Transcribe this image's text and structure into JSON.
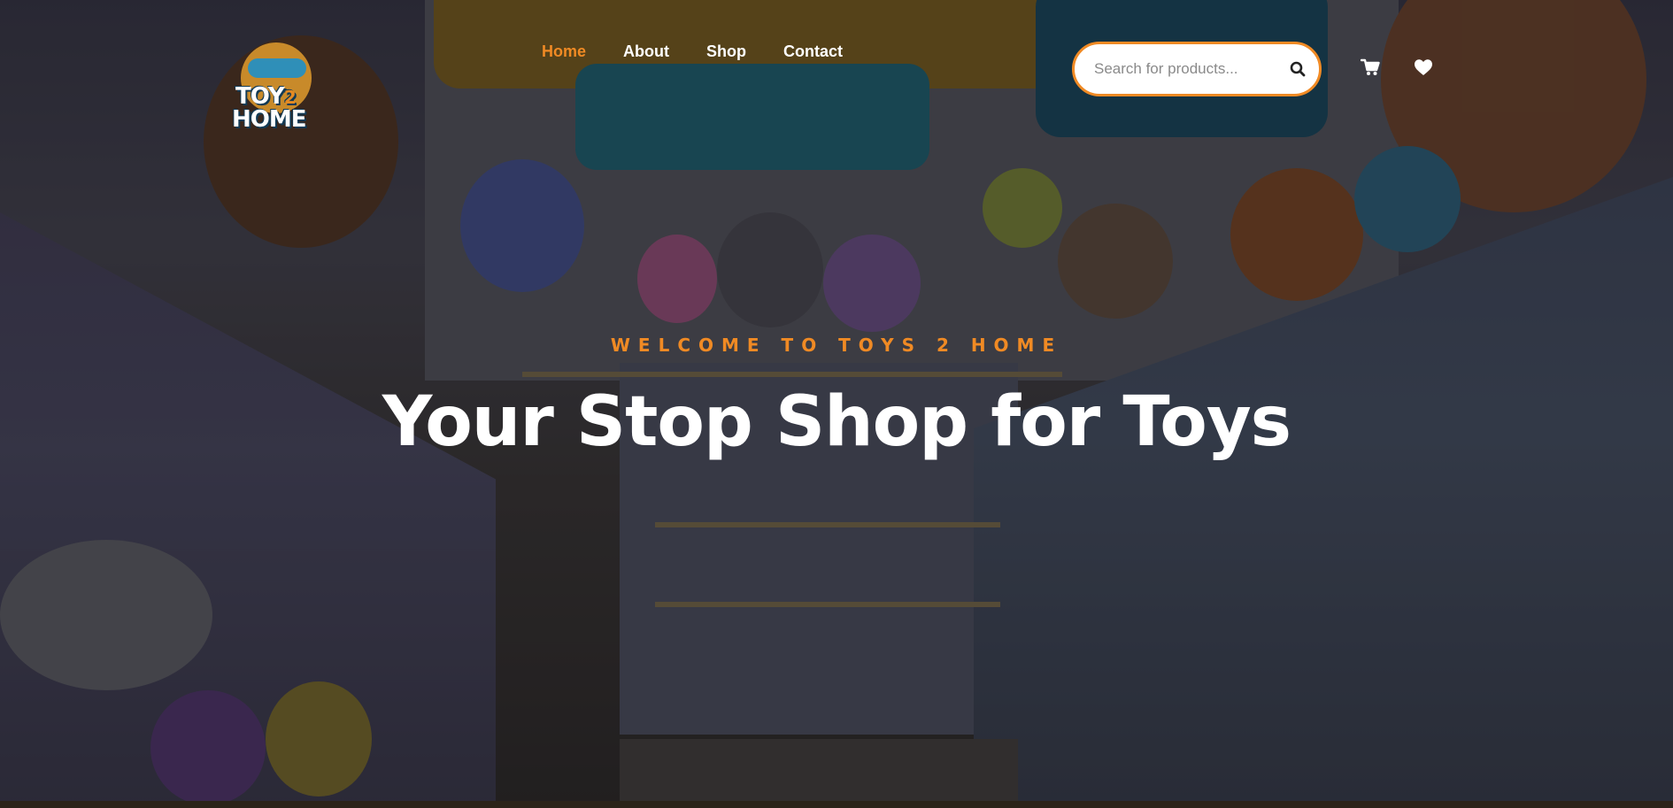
{
  "brand": {
    "logo_line1": "TOY",
    "logo_two": "2",
    "logo_line2": "HOME",
    "accent_color": "#f08a24"
  },
  "nav": {
    "items": [
      {
        "label": "Home",
        "active": true
      },
      {
        "label": "About",
        "active": false
      },
      {
        "label": "Shop",
        "active": false
      },
      {
        "label": "Contact",
        "active": false
      }
    ]
  },
  "search": {
    "placeholder": "Search for products...",
    "value": "",
    "icon": "search-icon"
  },
  "header_icons": {
    "cart": "cart-icon",
    "wishlist": "heart-icon"
  },
  "hero": {
    "eyebrow": "WELCOME TO TOYS 2 HOME",
    "headline": "Your Stop Shop for Toys"
  }
}
